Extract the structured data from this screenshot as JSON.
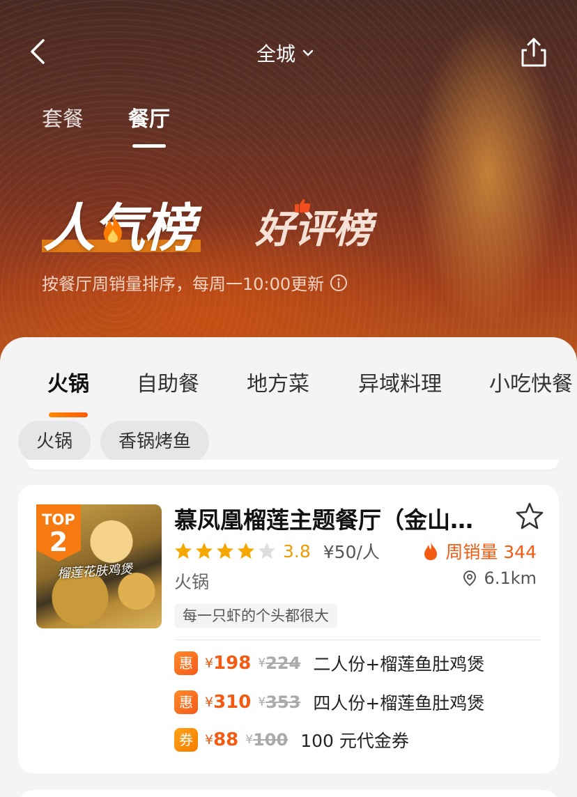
{
  "nav": {
    "city": "全城"
  },
  "top_tabs": [
    {
      "label": "套餐"
    },
    {
      "label": "餐厅"
    }
  ],
  "ranking": {
    "main_title": "人气榜",
    "alt_title": "好评榜",
    "description": "按餐厅周销量排序，每周一10:00更新"
  },
  "category_tabs": [
    "火锅",
    "自助餐",
    "地方菜",
    "异域料理",
    "小吃快餐"
  ],
  "chips": [
    "火锅",
    "香锅烤鱼"
  ],
  "restaurant": {
    "rank_top": "TOP",
    "rank_num": "2",
    "thumb_caption": "榴莲花肤鸡煲",
    "name": "慕凤凰榴莲主题餐厅（金山…",
    "rating": 3.8,
    "score": "3.8",
    "price": "¥50/人",
    "sales": "周销量 344",
    "category": "火锅",
    "distance": "6.1km",
    "tagline": "每一只虾的个头都很大",
    "deals": [
      {
        "badge": "惠",
        "yen": "¥",
        "now": "198",
        "was_yen": "¥",
        "was": "224",
        "desc": "二人份+榴莲鱼肚鸡煲"
      },
      {
        "badge": "惠",
        "yen": "¥",
        "now": "310",
        "was_yen": "¥",
        "was": "353",
        "desc": "四人份+榴莲鱼肚鸡煲"
      },
      {
        "badge": "券",
        "yen": "¥",
        "now": "88",
        "was_yen": "¥",
        "was": "100",
        "desc": "100 元代金券"
      }
    ]
  },
  "colors": {
    "accent": "#f35a12",
    "star": "#f5a700",
    "star_empty": "#dddddd"
  }
}
